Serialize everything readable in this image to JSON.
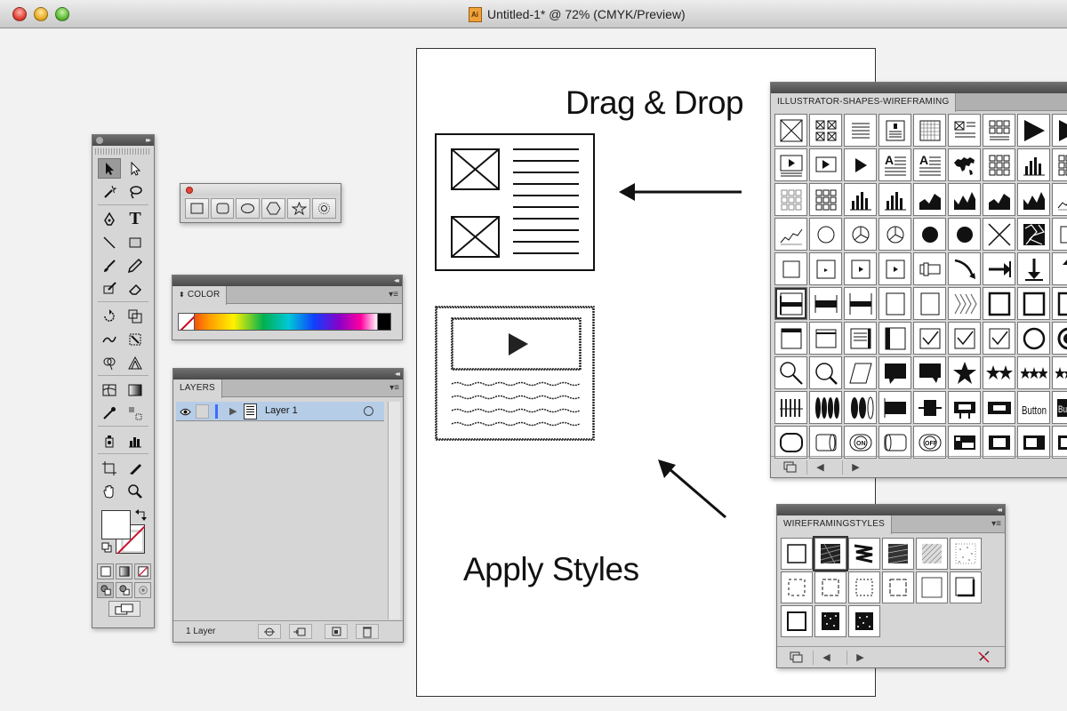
{
  "window": {
    "title": "Untitled-1* @ 72% (CMYK/Preview)"
  },
  "artboard": {
    "drag_label": "Drag & Drop",
    "styles_label": "Apply Styles"
  },
  "panels": {
    "color": {
      "tab": "COLOR",
      "collapse": "◂◂",
      "menu": "▾≡"
    },
    "layers": {
      "tab": "LAYERS",
      "collapse": "◂◂",
      "menu": "▾≡",
      "rows": [
        {
          "name": "Layer 1"
        }
      ],
      "count": "1 Layer"
    },
    "symbols": {
      "tab": "ILLUSTRATOR-SHAPES-WIREFRAMING",
      "collapse": "◂◂",
      "button_label": "Button",
      "on_label": "ON",
      "off_label": "OFF"
    },
    "styles": {
      "tab": "WIREFRAMINGSTYLES",
      "collapse": "◂◂",
      "menu": "▾≡"
    },
    "tools": {
      "collapse": "▸▸",
      "type_tool": "T"
    }
  },
  "icons": {
    "eye": "eye-icon",
    "arrow": "triangle-right-icon"
  },
  "colors": {
    "layer_selection": "#b6cde8",
    "layer_color": "#3d6cff",
    "none_slash": "#d0021b"
  }
}
